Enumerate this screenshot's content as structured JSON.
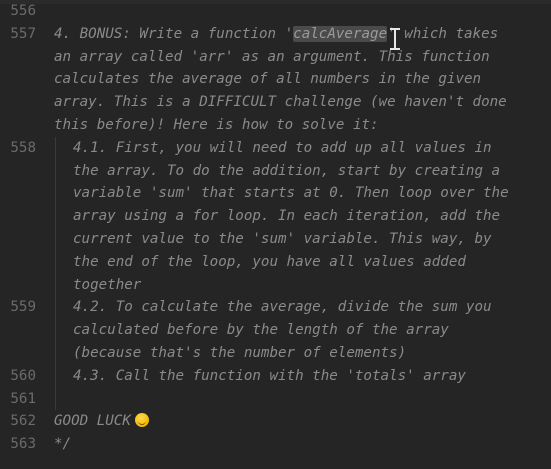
{
  "editor": {
    "lines": [
      {
        "num": "556",
        "text": "",
        "indent": false
      },
      {
        "num": "557",
        "pre": "4. BONUS: Write a function '",
        "hl": "calcAverage",
        "post": "' which takes",
        "indent": false,
        "highlighted": true
      },
      {
        "num": "",
        "text": "an array called 'arr' as an argument. This function",
        "indent": false
      },
      {
        "num": "",
        "text": "calculates the average of all numbers in the given",
        "indent": false
      },
      {
        "num": "",
        "text": "array. This is a DIFFICULT challenge (we haven't done",
        "indent": false
      },
      {
        "num": "",
        "text": "this before)! Here is how to solve it:",
        "indent": false
      },
      {
        "num": "558",
        "text": "4.1. First, you will need to add up all values in",
        "indent": true
      },
      {
        "num": "",
        "text": "the array. To do the addition, start by creating a",
        "indent": true
      },
      {
        "num": "",
        "text": "variable 'sum' that starts at 0. Then loop over the",
        "indent": true
      },
      {
        "num": "",
        "text": "array using a for loop. In each iteration, add the",
        "indent": true
      },
      {
        "num": "",
        "text": "current value to the 'sum' variable. This way, by",
        "indent": true
      },
      {
        "num": "",
        "text": "the end of the loop, you have all values added",
        "indent": true
      },
      {
        "num": "",
        "text": "together",
        "indent": true
      },
      {
        "num": "559",
        "text": "4.2. To calculate the average, divide the sum you",
        "indent": true
      },
      {
        "num": "",
        "text": "calculated before by the length of the array",
        "indent": true
      },
      {
        "num": "",
        "text": "(because that's the number of elements)",
        "indent": true
      },
      {
        "num": "560",
        "text": "4.3. Call the function with the 'totals' array",
        "indent": true
      },
      {
        "num": "561",
        "text": "",
        "indent": false,
        "guide": true
      },
      {
        "num": "562",
        "text": "GOOD LUCK",
        "indent": false,
        "emoji": "smiling-face-emoji"
      },
      {
        "num": "563",
        "text": "*/",
        "indent": false
      }
    ]
  },
  "colors": {
    "background": "#252525",
    "comment": "#8a8a8a",
    "gutter": "#6b6b6b",
    "selection": "#4a4a4a"
  }
}
